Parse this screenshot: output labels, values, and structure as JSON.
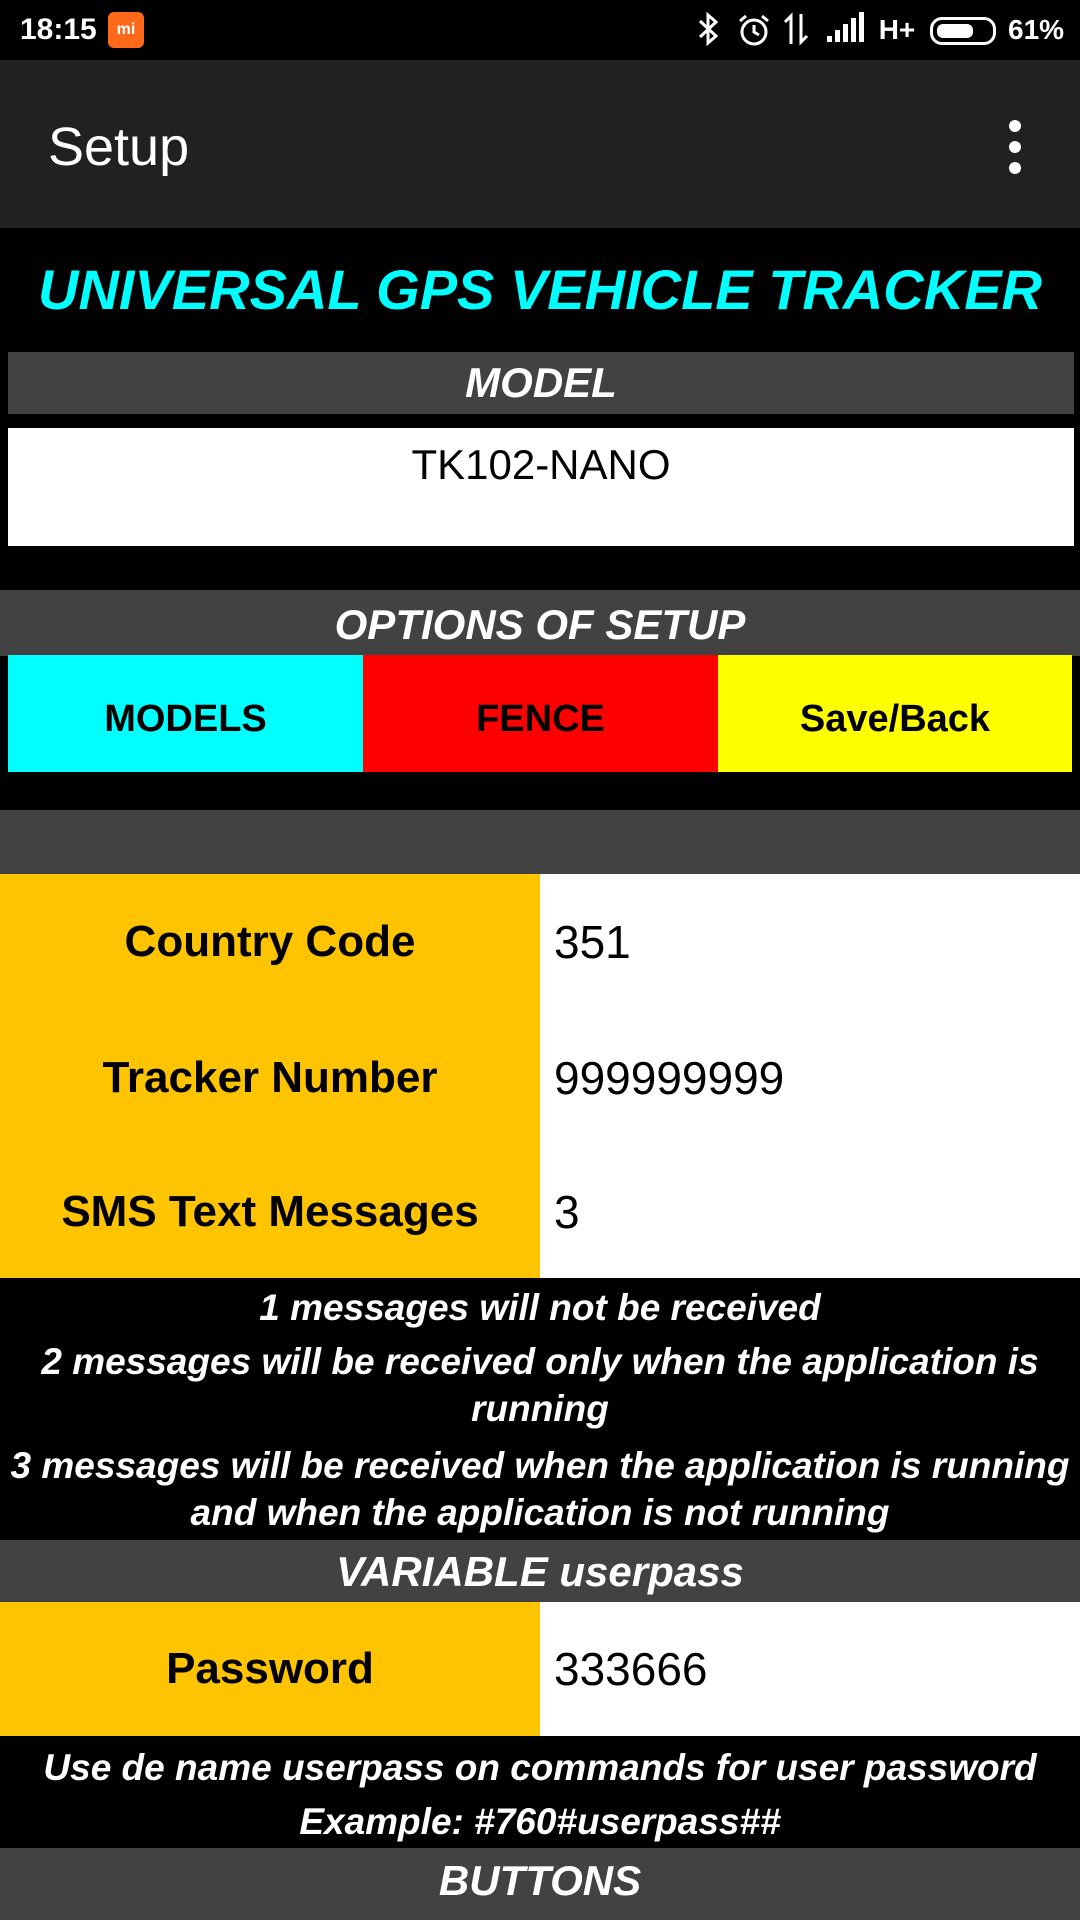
{
  "status_bar": {
    "time": "18:15",
    "battery_percent": "61%",
    "network_label": "H+",
    "icons": [
      "mi-icon",
      "bluetooth-icon",
      "alarm-icon",
      "data-transfer-icon",
      "signal-icon",
      "battery-icon"
    ]
  },
  "app_bar": {
    "title": "Setup",
    "menu_icon": "overflow-menu-icon"
  },
  "heading": "UNIVERSAL GPS VEHICLE TRACKER",
  "model_section": {
    "label": "MODEL",
    "value": "TK102-NANO"
  },
  "options_section": {
    "label": "OPTIONS OF SETUP",
    "buttons": [
      "MODELS",
      "FENCE",
      "Save/Back"
    ]
  },
  "fields": [
    {
      "label": "Country Code",
      "value": "351"
    },
    {
      "label": "Tracker Number",
      "value": "999999999"
    },
    {
      "label": "SMS Text Messages",
      "value": "3"
    }
  ],
  "sms_info": [
    "1 messages will not be received",
    "2 messages will be received only when the application is running",
    "3 messages will be received when the application is running and when the application is not running"
  ],
  "variable_section": {
    "label": "VARIABLE userpass",
    "field_label": "Password",
    "field_value": "333666",
    "hint": "Use de name userpass on commands for user password",
    "example": "Example: #760#userpass##"
  },
  "buttons_section": {
    "label": "BUTTONS"
  },
  "colors": {
    "heading": "#00ffff",
    "section_bar": "#424242",
    "label_cell": "#ffc400",
    "models_button": "#00ffff",
    "fence_button": "#ff0000",
    "saveback_button": "#ffff00"
  }
}
